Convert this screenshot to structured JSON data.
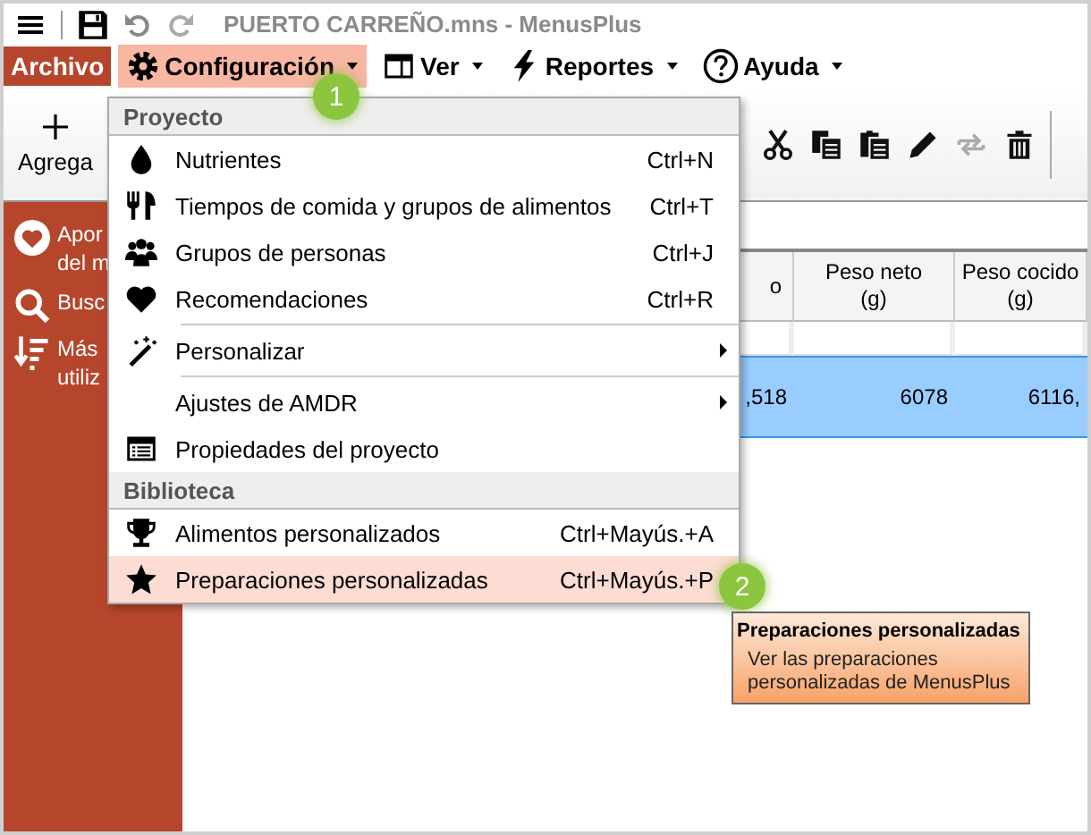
{
  "window": {
    "title": "PUERTO CARREÑO.mns - MenusPlus"
  },
  "menu_bar": [
    {
      "label": "Archivo",
      "kind": "file",
      "selected": false
    },
    {
      "label": "Configuración",
      "kind": "menu",
      "selected": true
    },
    {
      "label": "Ver",
      "kind": "menu",
      "selected": false
    },
    {
      "label": "Reportes",
      "kind": "menu",
      "selected": false
    },
    {
      "label": "Ayuda",
      "kind": "menu",
      "selected": false
    }
  ],
  "toolbar": {
    "add_label": "Agrega",
    "tools": [
      {
        "disabled": false
      },
      {
        "disabled": false
      },
      {
        "disabled": false
      },
      {
        "disabled": false
      },
      {
        "disabled": true
      },
      {
        "disabled": false
      }
    ]
  },
  "sidebar": {
    "items": [
      {
        "lines": [
          "Apor",
          "del m"
        ]
      },
      {
        "lines": [
          "Busc"
        ]
      },
      {
        "lines": [
          "Más",
          "utiliz"
        ]
      }
    ]
  },
  "table": {
    "columns": [
      {
        "lines": [
          "o"
        ]
      },
      {
        "lines": [
          "Peso neto",
          "(g)"
        ]
      },
      {
        "lines": [
          "Peso cocido",
          "(g)"
        ]
      }
    ],
    "rows": [
      {
        "cells": [
          ",518",
          "6078",
          "6116,"
        ],
        "selected": true
      }
    ]
  },
  "dropdown": {
    "sections": [
      {
        "header": "Proyecto",
        "items": [
          {
            "label": "Nutrientes",
            "shortcut": "Ctrl+N",
            "submenu": false,
            "separator_above": false,
            "selected": false
          },
          {
            "label": "Tiempos de comida y grupos de alimentos",
            "shortcut": "Ctrl+T",
            "submenu": false,
            "separator_above": false,
            "selected": false
          },
          {
            "label": "Grupos de personas",
            "shortcut": "Ctrl+J",
            "submenu": false,
            "separator_above": false,
            "selected": false
          },
          {
            "label": "Recomendaciones",
            "shortcut": "Ctrl+R",
            "submenu": false,
            "separator_above": false,
            "selected": false
          },
          {
            "label": "Personalizar",
            "submenu": true,
            "separator_above": true,
            "selected": false
          },
          {
            "label": "Ajustes de AMDR",
            "submenu": true,
            "separator_above": true,
            "selected": false
          },
          {
            "label": "Propiedades del proyecto",
            "submenu": false,
            "separator_above": false,
            "selected": false
          }
        ]
      },
      {
        "header": "Biblioteca",
        "items": [
          {
            "label": "Alimentos personalizados",
            "shortcut": "Ctrl+Mayús.+A",
            "submenu": false,
            "separator_above": false,
            "selected": false
          },
          {
            "label": "Preparaciones personalizadas",
            "shortcut": "Ctrl+Mayús.+P",
            "submenu": false,
            "separator_above": false,
            "selected": true
          }
        ]
      }
    ]
  },
  "tooltip": {
    "title": "Preparaciones personalizadas",
    "text": "Ver las preparaciones personalizadas de MenusPlus"
  },
  "callouts": [
    "1",
    "2"
  ]
}
